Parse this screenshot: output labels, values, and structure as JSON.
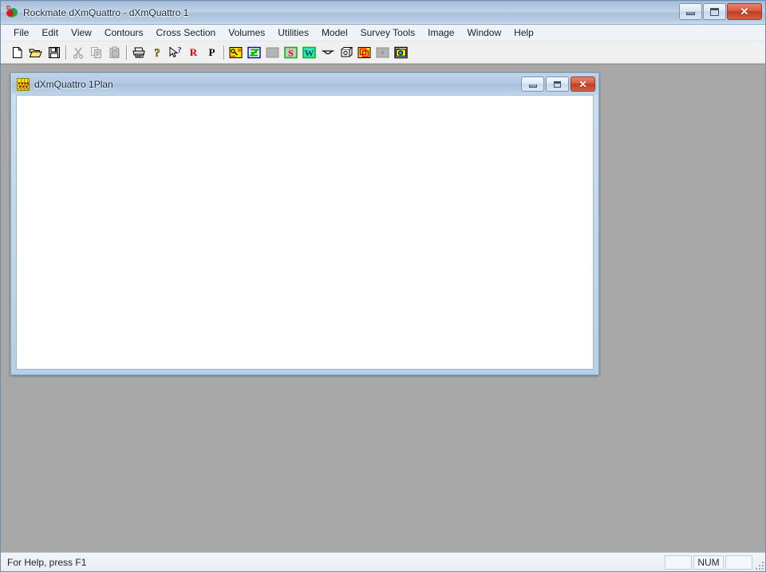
{
  "window": {
    "title": "Rockmate dXmQuattro - dXmQuattro 1",
    "app_icon": "app-logo-icon",
    "controls": {
      "minimize_label": "Minimize",
      "maximize_label": "Maximize",
      "close_label": "Close",
      "close_glyph": "✕"
    }
  },
  "menu": {
    "items": [
      {
        "label": "File"
      },
      {
        "label": "Edit"
      },
      {
        "label": "View"
      },
      {
        "label": "Contours"
      },
      {
        "label": "Cross Section"
      },
      {
        "label": "Volumes"
      },
      {
        "label": "Utilities"
      },
      {
        "label": "Model"
      },
      {
        "label": "Survey Tools"
      },
      {
        "label": "Image"
      },
      {
        "label": "Window"
      },
      {
        "label": "Help"
      }
    ]
  },
  "toolbar": {
    "buttons": [
      {
        "name": "new-document-icon",
        "tooltip": "New",
        "enabled": true
      },
      {
        "name": "open-folder-icon",
        "tooltip": "Open",
        "enabled": true
      },
      {
        "name": "save-disk-icon",
        "tooltip": "Save",
        "enabled": true
      },
      {
        "name": "cut-scissors-icon",
        "tooltip": "Cut",
        "enabled": false
      },
      {
        "name": "copy-pages-icon",
        "tooltip": "Copy",
        "enabled": false
      },
      {
        "name": "paste-clipboard-icon",
        "tooltip": "Paste",
        "enabled": false
      },
      {
        "name": "print-printer-icon",
        "tooltip": "Print",
        "enabled": true
      },
      {
        "name": "about-question-icon",
        "tooltip": "About",
        "enabled": true
      },
      {
        "name": "context-help-icon",
        "tooltip": "Context Help",
        "enabled": true
      },
      {
        "name": "letter-r-icon",
        "tooltip": "R",
        "label": "R",
        "color": "#e00000",
        "enabled": true
      },
      {
        "name": "letter-p-icon",
        "tooltip": "P",
        "label": "P",
        "color": "#000000",
        "enabled": true
      },
      {
        "name": "yellow-key-plot-icon",
        "tooltip": "Plot",
        "enabled": true
      },
      {
        "name": "green-z-contour-icon",
        "tooltip": "Contours",
        "enabled": true
      },
      {
        "name": "blank-disabled-icon",
        "tooltip": "",
        "enabled": false
      },
      {
        "name": "letter-s-green-icon",
        "tooltip": "S",
        "label": "S",
        "enabled": true
      },
      {
        "name": "letter-w-green-icon",
        "tooltip": "W",
        "label": "W",
        "enabled": true
      },
      {
        "name": "section-curve-icon",
        "tooltip": "Cross Section",
        "enabled": true
      },
      {
        "name": "cube-3d-icon",
        "tooltip": "3D Model",
        "enabled": true
      },
      {
        "name": "yellow-overlap-volumes-icon",
        "tooltip": "Volumes",
        "enabled": true
      },
      {
        "name": "blank-disabled-2-icon",
        "tooltip": "",
        "enabled": false
      },
      {
        "name": "camera-image-icon",
        "tooltip": "Image",
        "enabled": true
      }
    ]
  },
  "mdi_child": {
    "title": "dXmQuattro 1Plan",
    "icon": "grid-plan-icon",
    "controls": {
      "minimize_label": "Minimize",
      "restore_label": "Restore",
      "close_label": "Close",
      "close_glyph": "✕"
    },
    "canvas": {
      "content": ""
    }
  },
  "status_bar": {
    "message": "For Help, press F1",
    "panes": [
      {
        "name": "status-pane-caps",
        "text": ""
      },
      {
        "name": "status-pane-num",
        "text": "NUM"
      },
      {
        "name": "status-pane-scrl",
        "text": ""
      }
    ]
  },
  "colors": {
    "title_accent": "#b2c9e2",
    "close_red": "#bf3c24",
    "mdi_background": "#a8a8a8",
    "toolbar_bg": "#f0f0f0",
    "icon_red": "#e00000",
    "icon_yellow": "#ffe400",
    "icon_green": "#00c000"
  }
}
